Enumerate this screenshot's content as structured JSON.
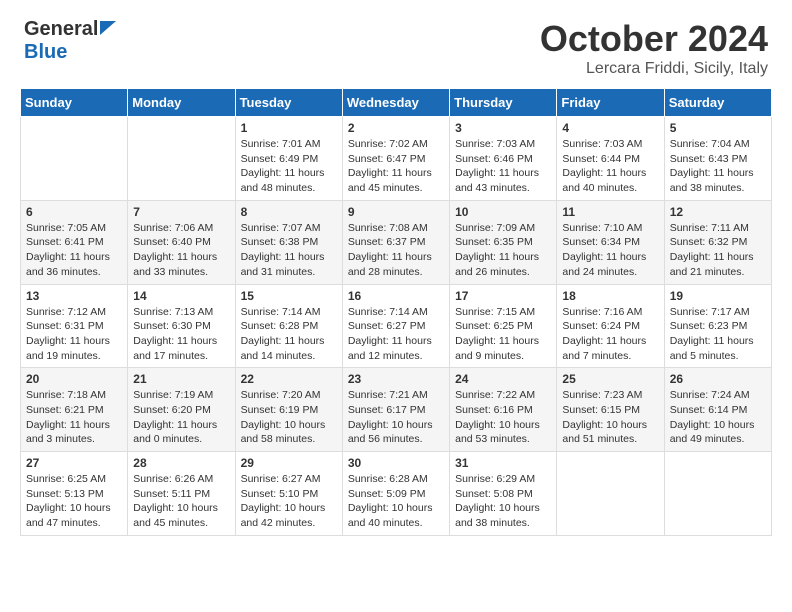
{
  "header": {
    "logo_line1": "General",
    "logo_line2": "Blue",
    "month": "October 2024",
    "location": "Lercara Friddi, Sicily, Italy"
  },
  "days_of_week": [
    "Sunday",
    "Monday",
    "Tuesday",
    "Wednesday",
    "Thursday",
    "Friday",
    "Saturday"
  ],
  "weeks": [
    [
      {
        "day": "",
        "content": ""
      },
      {
        "day": "",
        "content": ""
      },
      {
        "day": "1",
        "content": "Sunrise: 7:01 AM\nSunset: 6:49 PM\nDaylight: 11 hours and 48 minutes."
      },
      {
        "day": "2",
        "content": "Sunrise: 7:02 AM\nSunset: 6:47 PM\nDaylight: 11 hours and 45 minutes."
      },
      {
        "day": "3",
        "content": "Sunrise: 7:03 AM\nSunset: 6:46 PM\nDaylight: 11 hours and 43 minutes."
      },
      {
        "day": "4",
        "content": "Sunrise: 7:03 AM\nSunset: 6:44 PM\nDaylight: 11 hours and 40 minutes."
      },
      {
        "day": "5",
        "content": "Sunrise: 7:04 AM\nSunset: 6:43 PM\nDaylight: 11 hours and 38 minutes."
      }
    ],
    [
      {
        "day": "6",
        "content": "Sunrise: 7:05 AM\nSunset: 6:41 PM\nDaylight: 11 hours and 36 minutes."
      },
      {
        "day": "7",
        "content": "Sunrise: 7:06 AM\nSunset: 6:40 PM\nDaylight: 11 hours and 33 minutes."
      },
      {
        "day": "8",
        "content": "Sunrise: 7:07 AM\nSunset: 6:38 PM\nDaylight: 11 hours and 31 minutes."
      },
      {
        "day": "9",
        "content": "Sunrise: 7:08 AM\nSunset: 6:37 PM\nDaylight: 11 hours and 28 minutes."
      },
      {
        "day": "10",
        "content": "Sunrise: 7:09 AM\nSunset: 6:35 PM\nDaylight: 11 hours and 26 minutes."
      },
      {
        "day": "11",
        "content": "Sunrise: 7:10 AM\nSunset: 6:34 PM\nDaylight: 11 hours and 24 minutes."
      },
      {
        "day": "12",
        "content": "Sunrise: 7:11 AM\nSunset: 6:32 PM\nDaylight: 11 hours and 21 minutes."
      }
    ],
    [
      {
        "day": "13",
        "content": "Sunrise: 7:12 AM\nSunset: 6:31 PM\nDaylight: 11 hours and 19 minutes."
      },
      {
        "day": "14",
        "content": "Sunrise: 7:13 AM\nSunset: 6:30 PM\nDaylight: 11 hours and 17 minutes."
      },
      {
        "day": "15",
        "content": "Sunrise: 7:14 AM\nSunset: 6:28 PM\nDaylight: 11 hours and 14 minutes."
      },
      {
        "day": "16",
        "content": "Sunrise: 7:14 AM\nSunset: 6:27 PM\nDaylight: 11 hours and 12 minutes."
      },
      {
        "day": "17",
        "content": "Sunrise: 7:15 AM\nSunset: 6:25 PM\nDaylight: 11 hours and 9 minutes."
      },
      {
        "day": "18",
        "content": "Sunrise: 7:16 AM\nSunset: 6:24 PM\nDaylight: 11 hours and 7 minutes."
      },
      {
        "day": "19",
        "content": "Sunrise: 7:17 AM\nSunset: 6:23 PM\nDaylight: 11 hours and 5 minutes."
      }
    ],
    [
      {
        "day": "20",
        "content": "Sunrise: 7:18 AM\nSunset: 6:21 PM\nDaylight: 11 hours and 3 minutes."
      },
      {
        "day": "21",
        "content": "Sunrise: 7:19 AM\nSunset: 6:20 PM\nDaylight: 11 hours and 0 minutes."
      },
      {
        "day": "22",
        "content": "Sunrise: 7:20 AM\nSunset: 6:19 PM\nDaylight: 10 hours and 58 minutes."
      },
      {
        "day": "23",
        "content": "Sunrise: 7:21 AM\nSunset: 6:17 PM\nDaylight: 10 hours and 56 minutes."
      },
      {
        "day": "24",
        "content": "Sunrise: 7:22 AM\nSunset: 6:16 PM\nDaylight: 10 hours and 53 minutes."
      },
      {
        "day": "25",
        "content": "Sunrise: 7:23 AM\nSunset: 6:15 PM\nDaylight: 10 hours and 51 minutes."
      },
      {
        "day": "26",
        "content": "Sunrise: 7:24 AM\nSunset: 6:14 PM\nDaylight: 10 hours and 49 minutes."
      }
    ],
    [
      {
        "day": "27",
        "content": "Sunrise: 6:25 AM\nSunset: 5:13 PM\nDaylight: 10 hours and 47 minutes."
      },
      {
        "day": "28",
        "content": "Sunrise: 6:26 AM\nSunset: 5:11 PM\nDaylight: 10 hours and 45 minutes."
      },
      {
        "day": "29",
        "content": "Sunrise: 6:27 AM\nSunset: 5:10 PM\nDaylight: 10 hours and 42 minutes."
      },
      {
        "day": "30",
        "content": "Sunrise: 6:28 AM\nSunset: 5:09 PM\nDaylight: 10 hours and 40 minutes."
      },
      {
        "day": "31",
        "content": "Sunrise: 6:29 AM\nSunset: 5:08 PM\nDaylight: 10 hours and 38 minutes."
      },
      {
        "day": "",
        "content": ""
      },
      {
        "day": "",
        "content": ""
      }
    ]
  ]
}
